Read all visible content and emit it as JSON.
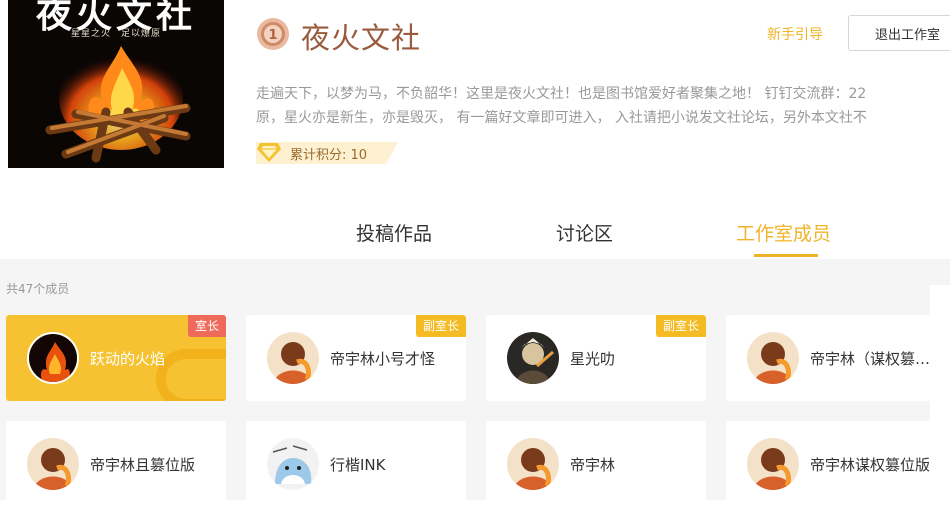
{
  "cover": {
    "title": "夜火文社",
    "subtitle": "星星之火　足以燎原"
  },
  "header": {
    "level": "1",
    "studio_name": "夜火文社",
    "guide_link": "新手引导",
    "exit_button": "退出工作室",
    "description_line1": "走遍天下，以梦为马，不负韶华！这里是夜火文社！也是图书馆爱好者聚集之地！ 钉钉交流群：22",
    "description_line2": "原，星火亦是新生，亦是毁灭， 有一篇好文章即可进入， 入社请把小说发文社论坛，另外本文社不",
    "score_label": "累计积分: 10"
  },
  "tabs": [
    {
      "label": "投稿作品",
      "active": false
    },
    {
      "label": "讨论区",
      "active": false
    },
    {
      "label": "工作室成员",
      "active": true
    }
  ],
  "members": {
    "count_label": "共47个成员",
    "list": [
      {
        "name": "跃动的火焰",
        "role": "室长"
      },
      {
        "name": "帝宇林小号才怪",
        "role": "副室长"
      },
      {
        "name": "星光叻",
        "role": "副室长"
      },
      {
        "name": "帝宇林（谋权篡位版）",
        "role": ""
      },
      {
        "name": "帝宇林且篡位版",
        "role": ""
      },
      {
        "name": "行楷INK",
        "role": ""
      },
      {
        "name": "帝宇林",
        "role": ""
      },
      {
        "name": "帝宇林谋权篡位版",
        "role": ""
      }
    ]
  },
  "colors": {
    "accent": "#f0b429",
    "leader_card": "#f7c232",
    "leader_badge": "#ef6a5a",
    "deputy_badge": "#f5bb22",
    "studio_name": "#9a5a3c"
  }
}
